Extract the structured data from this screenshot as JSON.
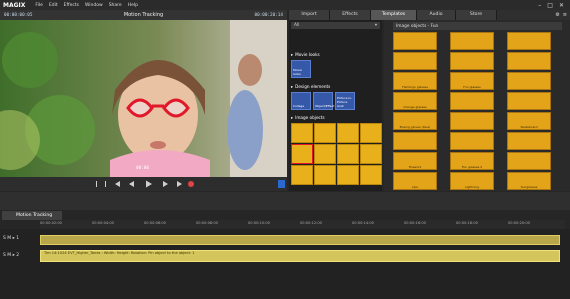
{
  "app": {
    "logo": "MAGIX"
  },
  "menu": {
    "items": [
      "File",
      "Edit",
      "Effects",
      "Window",
      "Share",
      "Help"
    ]
  },
  "preview": {
    "timecode_left": "00:00:00:05",
    "title": "Motion Tracking",
    "timecode_right": "00:00:20:14",
    "frame_label": "00:00"
  },
  "tabs": [
    {
      "label": "Import",
      "active": false
    },
    {
      "label": "Effects",
      "active": false
    },
    {
      "label": "Templates",
      "active": true
    },
    {
      "label": "Audio",
      "active": false
    },
    {
      "label": "Store",
      "active": false
    }
  ],
  "tree": {
    "selector": "All",
    "sections": [
      {
        "label": "Movie looks"
      },
      {
        "label": "Design elements"
      },
      {
        "label": "Image objects"
      }
    ],
    "design_tiles": [
      "Collage",
      "Object/Effect",
      "Picture-in-Picture Anst"
    ],
    "movie_tiles": [
      "Movie looks"
    ]
  },
  "grid": {
    "header": "Image objects - Fun",
    "labels": [
      "",
      "",
      "",
      "",
      "",
      "",
      "Flamingo glasses",
      "Fun glasses",
      "",
      "Orange glasses",
      "",
      "",
      "Boxing gloves (blue)",
      "",
      "Skateboard",
      "",
      "",
      "",
      "Firework",
      "Fun glasses 2",
      "",
      "Lips",
      "Lightning",
      "Sunglasses"
    ]
  },
  "arranger": {
    "track_tab": "Motion Tracking",
    "ruler": [
      "00:00:02:00",
      "00:00:04:00",
      "00:00:06:00",
      "00:00:08:00",
      "00:00:10:00",
      "00:00:12:00",
      "00:00:14:00",
      "00:00:16:00",
      "00:00:18:00",
      "00:00:20:00"
    ],
    "audio_clip": "Tim 14:1024 EVT_Higher_Tones : Width: Height: Rotation: Pin object to the object: 1"
  },
  "colors": {
    "accent": "#3658a8",
    "tile": "#e3a41a",
    "record": "#e04545"
  }
}
